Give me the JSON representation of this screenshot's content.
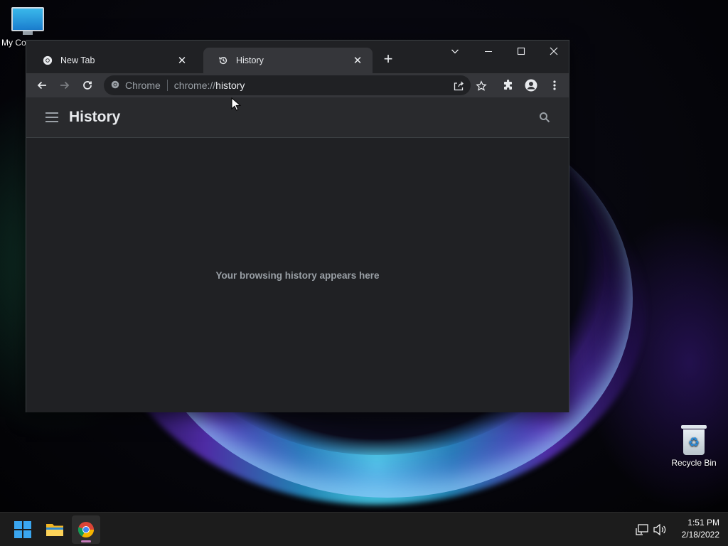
{
  "desktop": {
    "icons": [
      {
        "label": "My Co"
      },
      {
        "label": "Recycle Bin"
      }
    ]
  },
  "browser": {
    "tabs": [
      {
        "title": "New Tab",
        "icon": "chrome-icon",
        "active": false
      },
      {
        "title": "History",
        "icon": "history-icon",
        "active": true
      }
    ],
    "new_tab_label": "+",
    "omnibox": {
      "site_label": "Chrome",
      "url_scheme": "chrome://",
      "url_path": "history"
    }
  },
  "history_page": {
    "title": "History",
    "empty_message": "Your browsing history appears here"
  },
  "taskbar": {
    "apps": [
      "start-icon",
      "file-explorer-icon",
      "chrome-icon"
    ],
    "clock": {
      "time": "1:51 PM",
      "date": "2/18/2022"
    }
  },
  "colors": {
    "window_bg": "#202124",
    "toolbar_bg": "#35363a",
    "header_bg": "#292a2d",
    "text_primary": "#e8eaed",
    "text_secondary": "#9aa0a6",
    "taskbar_bg": "#1c1c1c",
    "chrome_indicator": "#c47ab9"
  }
}
